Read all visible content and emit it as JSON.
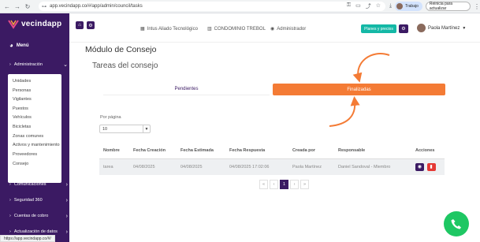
{
  "browser": {
    "url": "app.vecindapp.co/#/app/admin/council/tasks",
    "profile_label": "Trabajo",
    "finish_update_label": "Reinicia para actualizar"
  },
  "sidebar": {
    "logo_text": "vecindapp",
    "menu_title": "Menú",
    "items": [
      {
        "label": "Administración"
      },
      {
        "label": "Comunicaciones"
      },
      {
        "label": "Seguridad 360"
      },
      {
        "label": "Cuentas de cobro"
      },
      {
        "label": "Actualización de datos"
      }
    ],
    "submenu": [
      "Unidades",
      "Personas",
      "Vigilantes",
      "Puestos",
      "Vehículos",
      "Bicicletas",
      "Zonas comunes",
      "Activos y mantenimiento",
      "Proveedores",
      "Consejo"
    ]
  },
  "topbar": {
    "integration": "Intus Aliado Tecnológico",
    "condominium": "CONDOMINIO TREBOL",
    "role": "Administrador",
    "plans_button": "Planes y precios",
    "user_name": "Paola Martínez"
  },
  "page": {
    "module_title": "Módulo de Consejo",
    "card_title": "Tareas del consejo",
    "tabs": [
      {
        "label": "Pendientes",
        "active": false
      },
      {
        "label": "Finalizadas",
        "active": true
      }
    ],
    "per_page_label": "Por página",
    "per_page_value": "10"
  },
  "table": {
    "headers": [
      "Nombre",
      "Fecha Creación",
      "Fecha Estimada",
      "Fecha Respuesta",
      "Creada por",
      "Responsable",
      "Acciones"
    ],
    "rows": [
      [
        "tarea",
        "04/08/2025",
        "04/08/2025",
        "04/08/2025 17:02:06",
        "Paola Martínez",
        "Daniel Sandoval - Miembro"
      ]
    ]
  },
  "pagination": {
    "first": "«",
    "prev": "‹",
    "current": "1",
    "next": "›",
    "last": "»"
  },
  "status_bar_url": "https://app.vecindapp.co/#/",
  "colors": {
    "brand_purple": "#3b1a63",
    "accent_orange": "#f47b35",
    "plans_teal": "#14b8a6",
    "whatsapp_green": "#1ec763",
    "delete_red": "#e53935"
  }
}
